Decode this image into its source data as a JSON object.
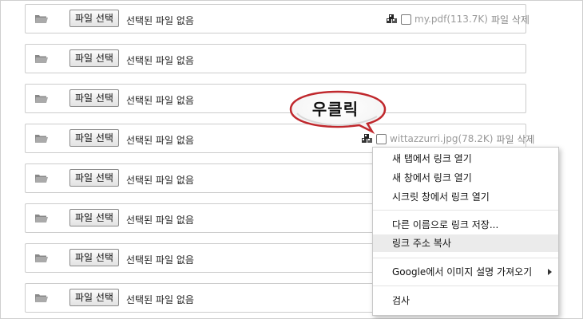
{
  "rows": [
    {
      "button": "파일 선택",
      "status": "선택된 파일 없음",
      "attachment": {
        "name": "my.pdf(113.7K)",
        "delete": "파일 삭제"
      }
    },
    {
      "button": "파일 선택",
      "status": "선택된 파일 없음"
    },
    {
      "button": "파일 선택",
      "status": "선택된 파일 없음"
    },
    {
      "button": "파일 선택",
      "status": "선택된 파일 없음",
      "attachment": {
        "name": "wittazzurri.jpg(78.2K)",
        "delete": "파일 삭제"
      }
    },
    {
      "button": "파일 선택",
      "status": "선택된 파일 없음"
    },
    {
      "button": "파일 선택",
      "status": "선택된 파일 없음"
    },
    {
      "button": "파일 선택",
      "status": "선택된 파일 없음"
    },
    {
      "button": "파일 선택",
      "status": "선택된 파일 없음"
    }
  ],
  "context_menu": {
    "items": [
      "새 탭에서 링크 열기",
      "새 창에서 링크 열기",
      "시크릿 창에서 링크 열기",
      "다른 이름으로 링크 저장...",
      "링크 주소 복사",
      "Google에서 이미지 설명 가져오기",
      "검사"
    ],
    "highlighted": "링크 주소 복사"
  },
  "callout": {
    "text": "우클릭"
  },
  "icons": {
    "row": "folder-icon",
    "attachment": "attachment-icon"
  },
  "colors": {
    "border": "#cccccc",
    "menu_highlight": "#ebebeb",
    "bubble_edge": "#c0282d"
  }
}
